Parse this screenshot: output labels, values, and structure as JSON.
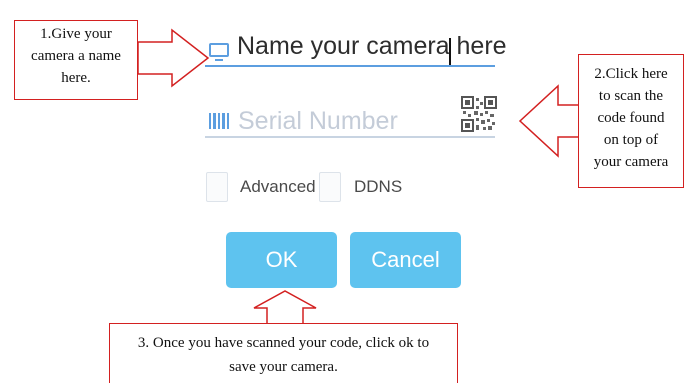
{
  "form": {
    "name_value": "Name your camera here",
    "serial_placeholder": "Serial Number",
    "advanced_label": "Advanced",
    "ddns_label": "DDNS",
    "ok_label": "OK",
    "cancel_label": "Cancel",
    "name_icon": "monitor-icon",
    "serial_icon": "barcode-icon",
    "scan_icon": "qr-code-icon",
    "accent_color": "#5ec3ef",
    "underline_color": "#5c9ee0"
  },
  "callouts": {
    "step1": [
      "1.Give your",
      "camera a name",
      "here."
    ],
    "step2": [
      "2.Click here",
      "to scan the",
      "code found",
      "on top of",
      "your camera"
    ],
    "step3": [
      "3. Once you have scanned your code, click ok to",
      "save your camera."
    ],
    "border_color": "#d32020"
  }
}
